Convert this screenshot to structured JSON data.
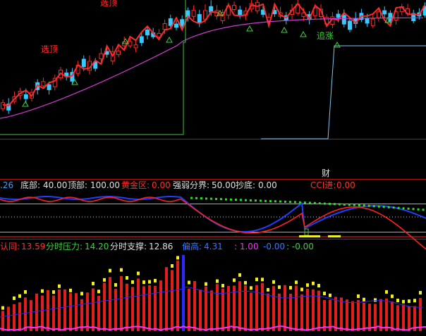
{
  "colors": {
    "background": "#000000",
    "up_candle": "#ff2a2a",
    "down_candle": "#39c8ff",
    "ma_line": "#d23ad2",
    "stop_line": "#7ac8f0",
    "stop_line_green": "#41c441",
    "kd_red": "#ff2020",
    "kd_blue": "#2040ff",
    "kd_green": "#28e028",
    "cyan_line": "#4fd4d4",
    "vol_red": "#e02020",
    "vol_yellow": "#f0f020",
    "vol_magenta": "#ff30ff",
    "signal_triangle": "#40d040",
    "label_red": "#ff3030",
    "label_green": "#40d040"
  },
  "main_panel": {
    "signals": {
      "top_pick_1": "选顶",
      "top_pick_2": "选顶",
      "chase": "追涨"
    }
  },
  "middle_panel": {
    "clipped_label": "财",
    "values_prefix": ".26",
    "bottom_label": "底部:",
    "bottom_value": "40.00",
    "top_label": "顶部:",
    "top_value": "100.00",
    "gold_label": "黄金区:",
    "gold_value": "0.00",
    "split_label": "强弱分界:",
    "split_value": "50.00",
    "copy_bottom_label": "抄底:",
    "copy_bottom_value": "0.00",
    "cci_label": "CCI进:",
    "cci_value": "0.00"
  },
  "volume_panel": {
    "recognize_label": "认同:",
    "recognize_value": "13.59",
    "pressure_label": "分时压力:",
    "pressure_value": "14.20",
    "support_label": "分时支撑:",
    "support_value": "12.86",
    "high_label": "偏高:",
    "high_value": "4.31",
    "v1": ": 1.00",
    "v2": "-0.00",
    "v3": ": -0.00"
  }
}
